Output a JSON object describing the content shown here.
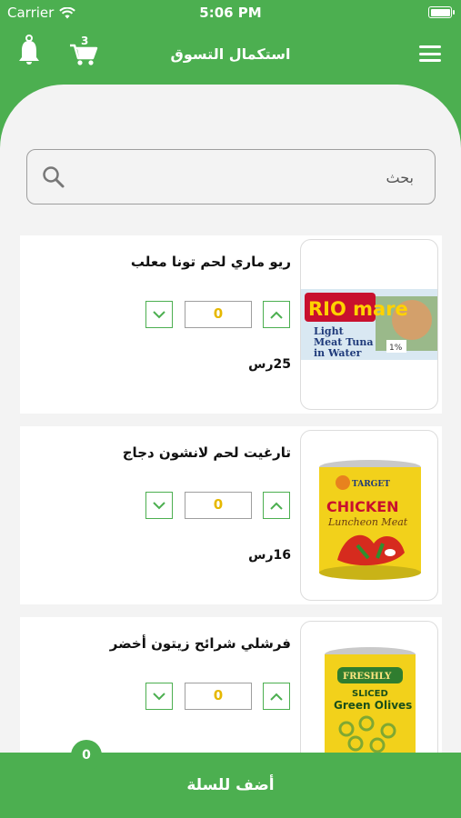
{
  "status": {
    "carrier": "Carrier",
    "time": "5:06 PM"
  },
  "header": {
    "title": "استكمال التسوق",
    "cart_count": "3"
  },
  "search": {
    "placeholder": "بحث"
  },
  "products": [
    {
      "name": "ريو ماري لحم تونا معلب",
      "price": "25رس",
      "quantity": "0",
      "image": {
        "brand": "RIO mare",
        "line1": "Light",
        "line2": "Meat Tuna",
        "line3": "in Water",
        "badge": "1%"
      }
    },
    {
      "name": "تارغيت لحم لانشون دجاج",
      "price": "16رس",
      "quantity": "0",
      "image": {
        "brand": "TARGET",
        "line1": "CHICKEN",
        "line2": "Luncheon Meat"
      }
    },
    {
      "name": "فرشلي شرائح زيتون أخضر",
      "price": "",
      "quantity": "0",
      "image": {
        "brand": "FRESHLY",
        "line1": "SLICED",
        "line2": "Green Olives"
      }
    }
  ],
  "bottom": {
    "add_label": "أضف للسلة",
    "count": "0"
  },
  "colors": {
    "primary": "#4caf50",
    "background": "#f3f3f3",
    "quantity_text": "#e6b800"
  }
}
